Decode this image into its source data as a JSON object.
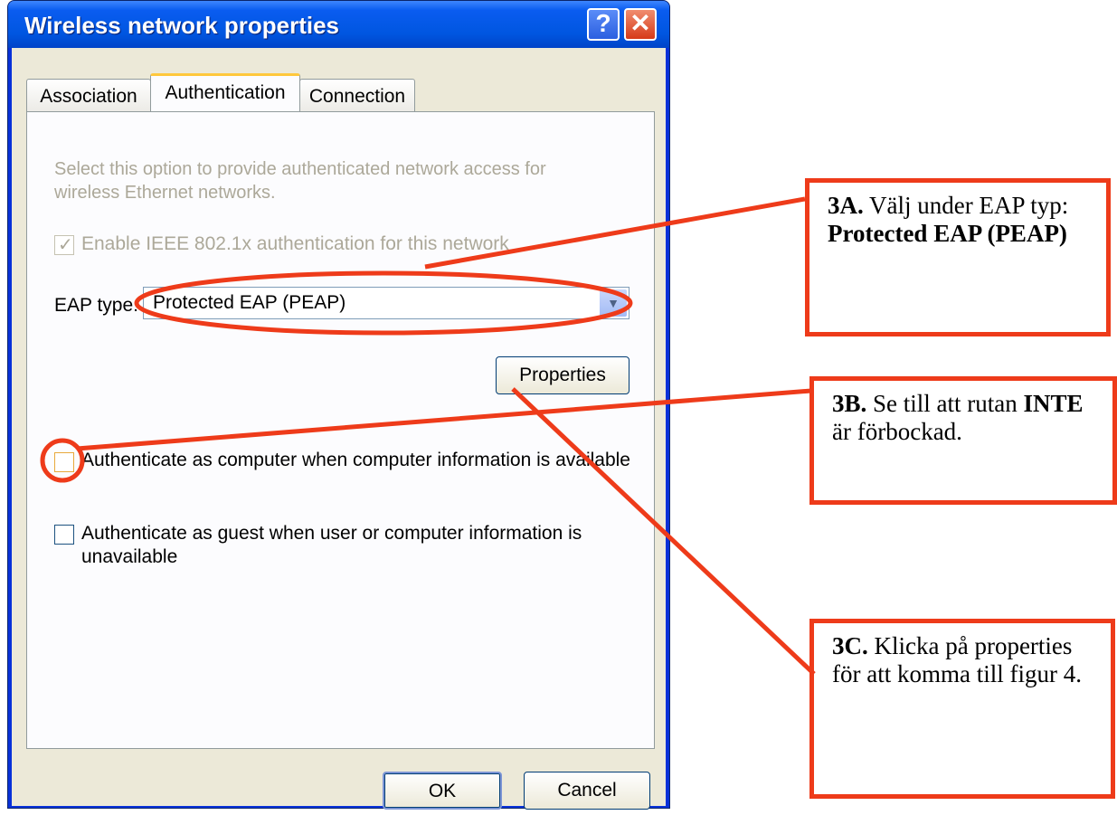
{
  "window": {
    "title": "Wireless network properties",
    "help_label": "?",
    "close_label": "✕"
  },
  "tabs": [
    {
      "label": "Association",
      "active": false
    },
    {
      "label": "Authentication",
      "active": true
    },
    {
      "label": "Connection",
      "active": false
    }
  ],
  "auth": {
    "description": "Select this option to provide authenticated network access for wireless Ethernet networks.",
    "enable_8021x": {
      "label": "Enable IEEE 802.1x authentication for this network",
      "checked": true,
      "disabled": true
    },
    "eap_type_label": "EAP type:",
    "eap_type_value": "Protected EAP (PEAP)",
    "properties_label": "Properties",
    "auth_as_computer": {
      "label": "Authenticate as computer when computer information is available",
      "checked": false
    },
    "auth_as_guest": {
      "label": "Authenticate as guest when user or computer information is unavailable",
      "checked": false
    }
  },
  "footer": {
    "ok_label": "OK",
    "cancel_label": "Cancel"
  },
  "callouts": {
    "c3a": {
      "lead": "3A.",
      "text": " Välj under EAP typ:  ",
      "bold": "Protected EAP (PEAP)"
    },
    "c3b": {
      "lead": "3B.",
      "text": " Se till att rutan ",
      "bold": "INTE",
      "tail": " är förbockad."
    },
    "c3c": {
      "lead": "3C.",
      "text": " Klicka på properties för att komma till figur 4."
    }
  },
  "colors": {
    "annotation": "#ee3b1a",
    "titlebar": "#0054e3"
  }
}
